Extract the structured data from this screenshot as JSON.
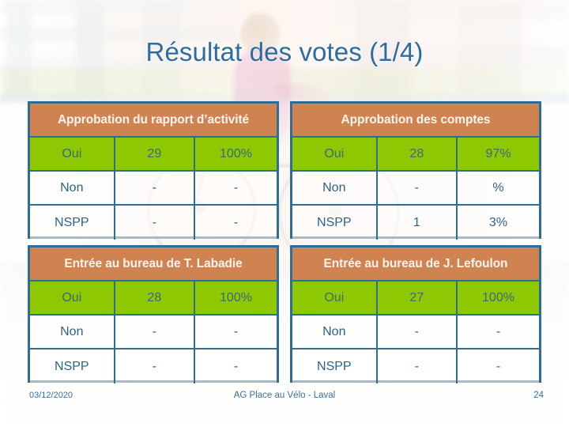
{
  "slide": {
    "title": "Résultat des votes (1/4)",
    "title_color": "#2F6C9E",
    "header_color": "#CE8350",
    "highlight_row_color": "#8EC802",
    "border_color": "#2E6E96"
  },
  "tables": [
    {
      "header": "Approbation du rapport d’activité",
      "rows": [
        {
          "label": "Oui",
          "count": "29",
          "percent": "100%",
          "highlight": true
        },
        {
          "label": "Non",
          "count": "-",
          "percent": "-",
          "highlight": false
        },
        {
          "label": "NSPP",
          "count": "-",
          "percent": "-",
          "highlight": false
        }
      ]
    },
    {
      "header": "Approbation des comptes",
      "rows": [
        {
          "label": "Oui",
          "count": "28",
          "percent": "97%",
          "highlight": true
        },
        {
          "label": "Non",
          "count": "-",
          "percent": "%",
          "highlight": false
        },
        {
          "label": "NSPP",
          "count": "1",
          "percent": "3%",
          "highlight": false
        }
      ]
    },
    {
      "header": "Entrée au bureau de T. Labadie",
      "rows": [
        {
          "label": "Oui",
          "count": "28",
          "percent": "100%",
          "highlight": true
        },
        {
          "label": "Non",
          "count": "-",
          "percent": "-",
          "highlight": false
        },
        {
          "label": "NSPP",
          "count": "-",
          "percent": "-",
          "highlight": false
        }
      ]
    },
    {
      "header": "Entrée au bureau de J. Lefoulon",
      "rows": [
        {
          "label": "Oui",
          "count": "27",
          "percent": "100%",
          "highlight": true
        },
        {
          "label": "Non",
          "count": "-",
          "percent": "-",
          "highlight": false
        },
        {
          "label": "NSPP",
          "count": "-",
          "percent": "-",
          "highlight": false
        }
      ]
    }
  ],
  "footer": {
    "date": "03/12/2020",
    "center": "AG Place au Vélo - Laval",
    "page": "24"
  }
}
